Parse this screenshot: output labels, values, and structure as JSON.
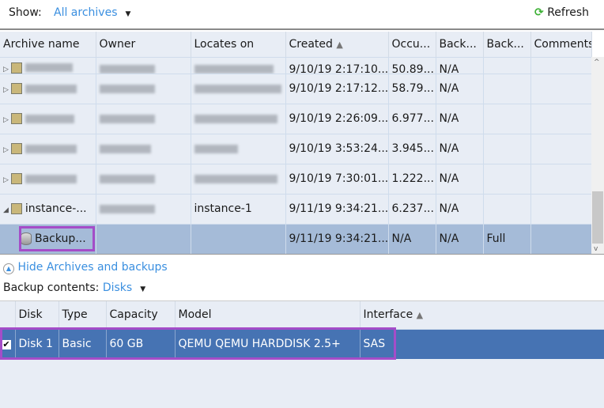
{
  "toolbar": {
    "show_label": "Show:",
    "show_value": "All archives",
    "refresh": "Refresh",
    "refresh_color": "#3cb034"
  },
  "archives": {
    "columns": [
      "Archive name",
      "Owner",
      "Locates on",
      "Created",
      "Occu...",
      "Back...",
      "Back...",
      "Comments"
    ],
    "sort_column": "Created",
    "rows": [
      {
        "name": "",
        "owner": "",
        "locates": "",
        "created": "9/10/19 2:17:10...",
        "occupied": "50.89...",
        "b1": "N/A",
        "b2": ""
      },
      {
        "name": "",
        "owner": "",
        "locates": "",
        "created": "9/10/19 2:17:12...",
        "occupied": "58.79...",
        "b1": "N/A",
        "b2": ""
      },
      {
        "name": "",
        "owner": "",
        "locates": "",
        "created": "9/10/19 2:26:09...",
        "occupied": "6.977...",
        "b1": "N/A",
        "b2": ""
      },
      {
        "name": "",
        "owner": "",
        "locates": "",
        "created": "9/10/19 3:53:24...",
        "occupied": "3.945...",
        "b1": "N/A",
        "b2": ""
      },
      {
        "name": "",
        "owner": "",
        "locates": "",
        "created": "9/10/19 7:30:01...",
        "occupied": "1.222...",
        "b1": "N/A",
        "b2": ""
      },
      {
        "name": "instance-...",
        "owner": "",
        "locates": "instance-1",
        "created": "9/11/19 9:34:21...",
        "occupied": "6.237...",
        "b1": "N/A",
        "b2": ""
      },
      {
        "name": "Backup...",
        "owner": "",
        "locates": "",
        "created": "9/11/19 9:34:21...",
        "occupied": "N/A",
        "b1": "N/A",
        "b2": "Full"
      }
    ]
  },
  "hide_link": "Hide Archives and backups",
  "contents": {
    "label": "Backup contents:",
    "value": "Disks"
  },
  "disks": {
    "columns": [
      "Disk",
      "Type",
      "Capacity",
      "Model",
      "Interface"
    ],
    "sort_column": "Interface",
    "rows": [
      {
        "checked": true,
        "disk": "Disk 1",
        "type": "Basic",
        "capacity": "60 GB",
        "model": "QEMU QEMU HARDDISK 2.5+",
        "interface": "SAS"
      }
    ]
  },
  "colors": {
    "selection": "#4673b3",
    "highlight_outline": "#a44dc8",
    "link": "#3a8fe0"
  }
}
